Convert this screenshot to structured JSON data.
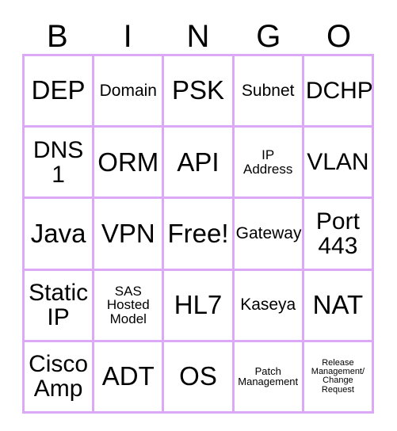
{
  "card": {
    "title_letters": [
      "B",
      "I",
      "N",
      "G",
      "O"
    ],
    "grid_color": "#dba9f5",
    "text_color": "#000000",
    "background_color": "#ffffff",
    "rows": [
      [
        {
          "text": "DEP",
          "size": "xl"
        },
        {
          "text": "Domain",
          "size": "md"
        },
        {
          "text": "PSK",
          "size": "xl"
        },
        {
          "text": "Subnet",
          "size": "md"
        },
        {
          "text": "DCHP",
          "size": "lg"
        }
      ],
      [
        {
          "text": "DNS\n1",
          "size": "lg"
        },
        {
          "text": "ORM",
          "size": "xl"
        },
        {
          "text": "API",
          "size": "xl"
        },
        {
          "text": "IP\nAddress",
          "size": "sm"
        },
        {
          "text": "VLAN",
          "size": "lg"
        }
      ],
      [
        {
          "text": "Java",
          "size": "xl"
        },
        {
          "text": "VPN",
          "size": "xl"
        },
        {
          "text": "Free!",
          "size": "xl"
        },
        {
          "text": "Gateway",
          "size": "md"
        },
        {
          "text": "Port\n443",
          "size": "lg"
        }
      ],
      [
        {
          "text": "Static\nIP",
          "size": "lg"
        },
        {
          "text": "SAS\nHosted\nModel",
          "size": "sm"
        },
        {
          "text": "HL7",
          "size": "xl"
        },
        {
          "text": "Kaseya",
          "size": "md"
        },
        {
          "text": "NAT",
          "size": "xl"
        }
      ],
      [
        {
          "text": "Cisco\nAmp",
          "size": "lg"
        },
        {
          "text": "ADT",
          "size": "xl"
        },
        {
          "text": "OS",
          "size": "xl"
        },
        {
          "text": "Patch\nManagement",
          "size": "xs"
        },
        {
          "text": "Release\nManagement/\nChange\nRequest",
          "size": "xxs"
        }
      ]
    ]
  }
}
